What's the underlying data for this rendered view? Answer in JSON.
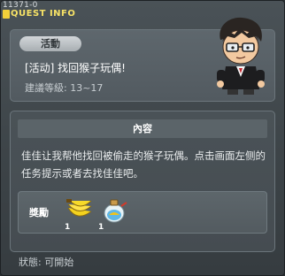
{
  "window": {
    "quest_id": "11371-0",
    "title": "QUEST INFO"
  },
  "quest": {
    "category_tag": "活動",
    "name": "[活动] 找回猴子玩偶!",
    "level_requirement": "建議等級: 13~17"
  },
  "content": {
    "header": "內容",
    "description": "佳佳让我帮他找回被偷走的猴子玩偶。点击画面左侧的任务提示或者去找佳佳吧。"
  },
  "rewards": {
    "label": "獎勵",
    "items": [
      {
        "icon": "banana-bunch-icon",
        "count": "1"
      },
      {
        "icon": "potion-bottle-icon",
        "count": "1"
      }
    ]
  },
  "status": {
    "text": "狀態: 可開始"
  }
}
